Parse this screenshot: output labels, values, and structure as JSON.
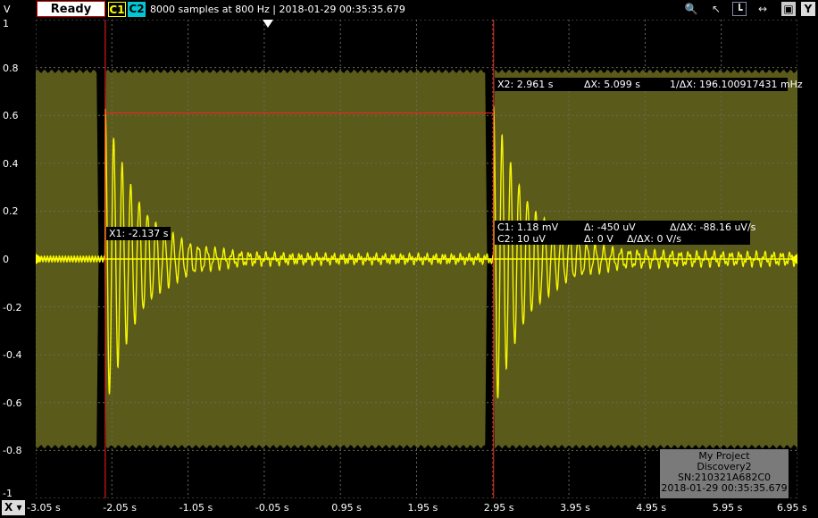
{
  "toolbar": {
    "status": "Ready",
    "ch1": "C1",
    "ch2": "C2",
    "info": "8000 samples at 800 Hz | 2018-01-29 00:35:35.679",
    "icons": [
      "zoom-icon",
      "cursor-icon",
      "axis-icon",
      "x-ruler-icon",
      "print-icon",
      "y-axis-icon"
    ],
    "y_button": "Y"
  },
  "axes": {
    "y_unit": "V",
    "y_ticks": [
      "1",
      "0.8",
      "0.6",
      "0.4",
      "0.2",
      "0",
      "-0.2",
      "-0.4",
      "-0.6",
      "-0.8",
      "-1"
    ],
    "x_ticks": [
      "-3.05 s",
      "-2.05 s",
      "-1.05 s",
      "-0.05 s",
      "0.95 s",
      "1.95 s",
      "2.95 s",
      "3.95 s",
      "4.95 s",
      "5.95 s",
      "6.95 s"
    ],
    "x_button": "X"
  },
  "cursors": {
    "x1": "X1: -2.137 s",
    "x2": "X2: 2.961 s",
    "dx": "ΔX: 5.099 s",
    "inv_dx": "1/ΔX: 196.100917431 mHz",
    "c1_val": "C1: 1.18 mV",
    "c1_delta": "Δ: -450 uV",
    "c1_rate": "Δ/ΔX: -88.16 uV/s",
    "c2_val": "C2: 10 uV",
    "c2_delta": "Δ: 0 V",
    "c2_rate": "Δ/ΔX: 0 V/s"
  },
  "device": {
    "line1": "My Project",
    "line2": "Discovery2",
    "line3": "SN:210321A682C0",
    "line4": "2018-01-29 00:35:35.679"
  },
  "chart_data": {
    "type": "line",
    "xlabel": "",
    "ylabel": "V",
    "xlim": [
      -3.05,
      6.95
    ],
    "ylim": [
      -1,
      1
    ],
    "grid": true,
    "series": [
      {
        "color": "#ffff00",
        "description_envelope_volts": 0.8,
        "impulses_s": [
          -2.137,
          2.961
        ],
        "impulse_peak_v": 0.62,
        "impulse_trough_v": -0.62
      }
    ],
    "cursor_x1": -2.137,
    "cursor_x2": 2.961,
    "cursor_level_v": 0.61
  },
  "colors": {
    "signal": "#ffff00",
    "envelope": "#5a5a1a",
    "cursor": "#ff2020",
    "grid": "#6a6a5a"
  }
}
